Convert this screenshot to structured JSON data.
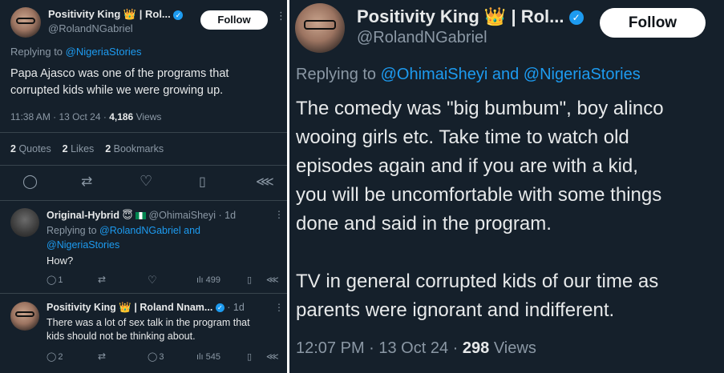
{
  "left": {
    "main_tweet": {
      "author_name": "Positivity King",
      "crown_glyph": "👑",
      "author_suffix": "| Rol...",
      "handle": "@RolandNGabriel",
      "follow_label": "Follow",
      "replying_prefix": "Replying to",
      "replying_to": "@NigeriaStories",
      "text_line1": "Papa Ajasco was one of the programs that",
      "text_line2": "corrupted kids while we were growing up.",
      "timestamp": "11:38 AM · 13 Oct 24 ·",
      "views_count": "4,186",
      "views_label": "Views",
      "quotes_count": "2",
      "quotes_label": "Quotes",
      "likes_count": "2",
      "likes_label": "Likes",
      "bookmarks_count": "2",
      "bookmarks_label": "Bookmarks"
    },
    "reply1": {
      "author_name": "Original-Hybrid",
      "handle": "@OhimaiSheyi",
      "age": "· 1d",
      "replying_prefix": "Replying to",
      "replying_line1": "@RolandNGabriel and",
      "replying_line2": "@NigeriaStories",
      "text": "How?",
      "reply_count": "1",
      "views": "499"
    },
    "reply2": {
      "author_name": "Positivity King",
      "author_suffix": "| Roland Nnam...",
      "age": "· 1d",
      "text_line1": "There was a lot of sex talk in the program that",
      "text_line2": "kids should not be thinking about.",
      "reply_count": "2",
      "like_count": "3",
      "views": "545"
    }
  },
  "right": {
    "author_name": "Positivity King",
    "author_suffix": "| Rol...",
    "handle": "@RolandNGabriel",
    "follow_label": "Follow",
    "replying_prefix": "Replying to",
    "replying_to": "@OhimaiSheyi and @NigeriaStories",
    "body_lines": [
      "The comedy was \"big bumbum\", boy alinco",
      "wooing girls etc. Take time to watch old",
      "episodes again and if you are with a kid,",
      "you will be uncomfortable with some things",
      "done and said in the program."
    ],
    "body_para2_lines": [
      "TV in general corrupted kids of our time as",
      "parents were ignorant and indifferent."
    ],
    "timestamp": "12:07 PM · 13 Oct 24 ·",
    "views_count": "298",
    "views_label": "Views"
  },
  "colors": {
    "background": "#15202b",
    "text": "#e7e9ea",
    "muted": "#8b98a5",
    "link": "#1d9bf0",
    "divider": "#38444d"
  }
}
